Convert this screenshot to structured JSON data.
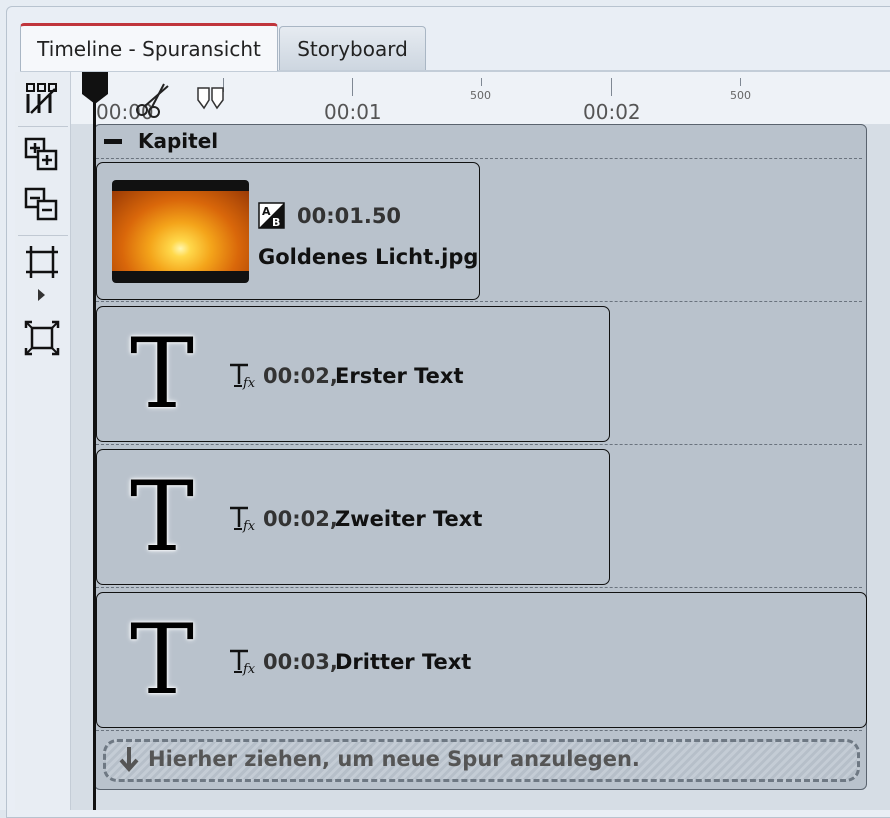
{
  "tabs": [
    {
      "label": "Timeline - Spuransicht",
      "active": true
    },
    {
      "label": "Storyboard",
      "active": false
    }
  ],
  "toolbar": {
    "icons": [
      "grid-cut-icon",
      "add-track-icon",
      "remove-track-icon",
      "fit-width-icon",
      "fit-all-icon"
    ]
  },
  "ruler": {
    "labels": [
      "00:00",
      "00:01",
      "00:02"
    ],
    "minor_labels": [
      "500",
      "500"
    ]
  },
  "chapter": {
    "title": "Kapitel"
  },
  "clips": [
    {
      "type": "image",
      "time": "00:01.50",
      "name": "Goldenes Licht.jpg"
    },
    {
      "type": "text",
      "glyph": "T",
      "time": "00:02,",
      "name": "Erster Text"
    },
    {
      "type": "text",
      "glyph": "T",
      "time": "00:02,",
      "name": "Zweiter Text"
    },
    {
      "type": "text",
      "glyph": "T",
      "time": "00:03,",
      "name": "Dritter Text"
    }
  ],
  "dropzone": {
    "label": "Hierher ziehen, um neue Spur anzulegen."
  },
  "colors": {
    "active_tab_accent": "#c0353c",
    "clip_background": "#b9c2cc",
    "panel_background": "#d3dbe4"
  }
}
